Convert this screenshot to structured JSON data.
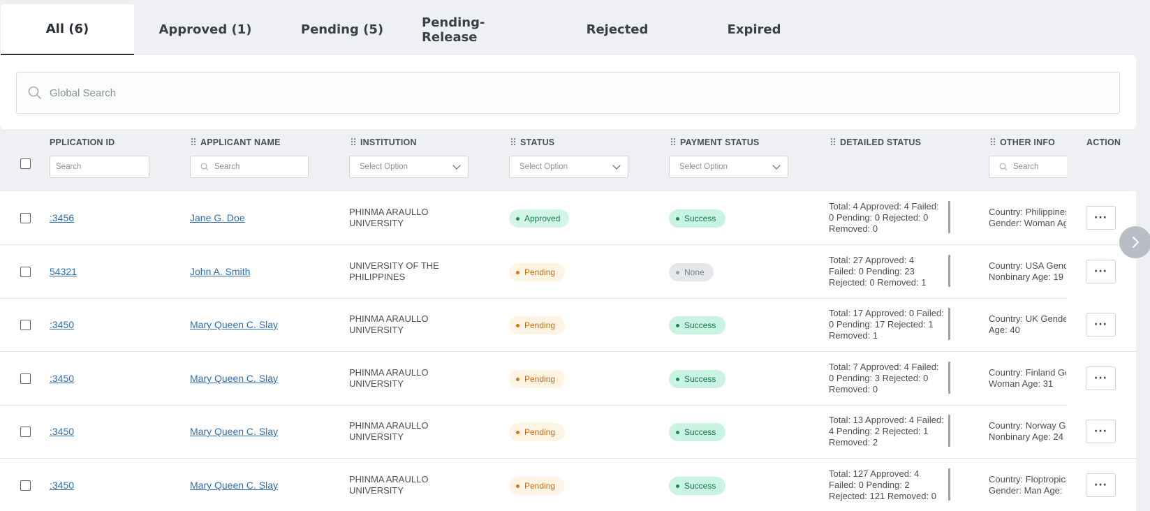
{
  "tabs": [
    {
      "label": "All (6)",
      "active": true
    },
    {
      "label": "Approved (1)"
    },
    {
      "label": "Pending (5)"
    },
    {
      "label": "Pending-Release"
    },
    {
      "label": "Rejected"
    },
    {
      "label": "Expired"
    }
  ],
  "global_search": {
    "placeholder": "Global Search"
  },
  "columns": {
    "application_id": {
      "label": "PPLICATION ID",
      "filter_placeholder": "Search"
    },
    "applicant_name": {
      "label": "APPLICANT NAME",
      "filter_placeholder": "Search"
    },
    "institution": {
      "label": "INSTITUTION",
      "filter_placeholder": "Select Option"
    },
    "status": {
      "label": "STATUS",
      "filter_placeholder": "Select Option"
    },
    "payment_status": {
      "label": "PAYMENT STATUS",
      "filter_placeholder": "Select Option"
    },
    "detailed_status": {
      "label": "DETAILED STATUS"
    },
    "other_info": {
      "label": "OTHER INFO",
      "filter_placeholder": "Search"
    },
    "action": {
      "label": "ACTION"
    }
  },
  "status_colors": {
    "approved": {
      "bg": "#d3f5e8",
      "fg": "#177a52",
      "dot": "#1a8a5c"
    },
    "pending": {
      "bg": "#fdf4e3",
      "fg": "#c96a12",
      "dot": "#d9730d"
    },
    "success": {
      "bg": "#c9f3e2",
      "fg": "#157550",
      "dot": "#1a8a5c"
    },
    "none": {
      "bg": "#e5e7eb",
      "fg": "#7c818a",
      "dot": "#9ca1a9"
    }
  },
  "rows": [
    {
      "id": ":3456",
      "name": "Jane G. Doe",
      "institution_1": "PHINMA ARAULLO",
      "institution_2": "UNIVERSITY",
      "status": "Approved",
      "payment": "Success",
      "detail_1": "Total: 4 Approved: 4 Failed:",
      "detail_2": "0 Pending: 0 Rejected: 0",
      "detail_3": "Removed: 0",
      "other_1": "Country: Philippines",
      "other_2": "Gender: Woman Age",
      "action": "···"
    },
    {
      "id": "54321",
      "name": "John A. Smith",
      "institution_1": "UNIVERSITY OF THE",
      "institution_2": "PHILIPPINES",
      "status": "Pending",
      "payment": "None",
      "detail_1": "Total: 27 Approved: 4",
      "detail_2": "Failed: 0 Pending: 23",
      "detail_3": "Rejected: 0 Removed: 1",
      "other_1": "Country: USA Gender:",
      "other_2": "Nonbinary Age: 19",
      "action": "···"
    },
    {
      "id": ":3450",
      "name": "Mary Queen C. Slay",
      "institution_1": "PHINMA ARAULLO",
      "institution_2": "UNIVERSITY",
      "status": "Pending",
      "payment": "Success",
      "detail_1": "Total: 17 Approved: 0 Failed:",
      "detail_2": "0 Pending: 17 Rejected: 1",
      "detail_3": "Removed: 1",
      "other_1": "Country: UK Gender:",
      "other_2": "Age: 40",
      "action": "···"
    },
    {
      "id": ":3450",
      "name": "Mary Queen C. Slay",
      "institution_1": "PHINMA ARAULLO",
      "institution_2": "UNIVERSITY",
      "status": "Pending",
      "payment": "Success",
      "detail_1": "Total: 7 Approved: 4 Failed:",
      "detail_2": "0 Pending: 3 Rejected: 0",
      "detail_3": "Removed: 0",
      "other_1": "Country: Finland Gender:",
      "other_2": "Woman Age: 31",
      "action": "···"
    },
    {
      "id": ":3450",
      "name": "Mary Queen C. Slay",
      "institution_1": "PHINMA ARAULLO",
      "institution_2": "UNIVERSITY",
      "status": "Pending",
      "payment": "Success",
      "detail_1": "Total: 13 Approved: 4 Failed:",
      "detail_2": "4 Pending: 2 Rejected: 1",
      "detail_3": "Removed: 2",
      "other_1": "Country: Norway Gender:",
      "other_2": "Nonbinary Age: 24",
      "action": "···"
    },
    {
      "id": ":3450",
      "name": "Mary Queen C. Slay",
      "institution_1": "PHINMA ARAULLO",
      "institution_2": "UNIVERSITY",
      "status": "Pending",
      "payment": "Success",
      "detail_1": "Total: 127 Approved: 4",
      "detail_2": "Failed: 0 Pending: 2",
      "detail_3": "Rejected: 121 Removed: 0",
      "other_1": "Country: Floptropica",
      "other_2": "Gender: Man Age:",
      "action": "···"
    }
  ]
}
